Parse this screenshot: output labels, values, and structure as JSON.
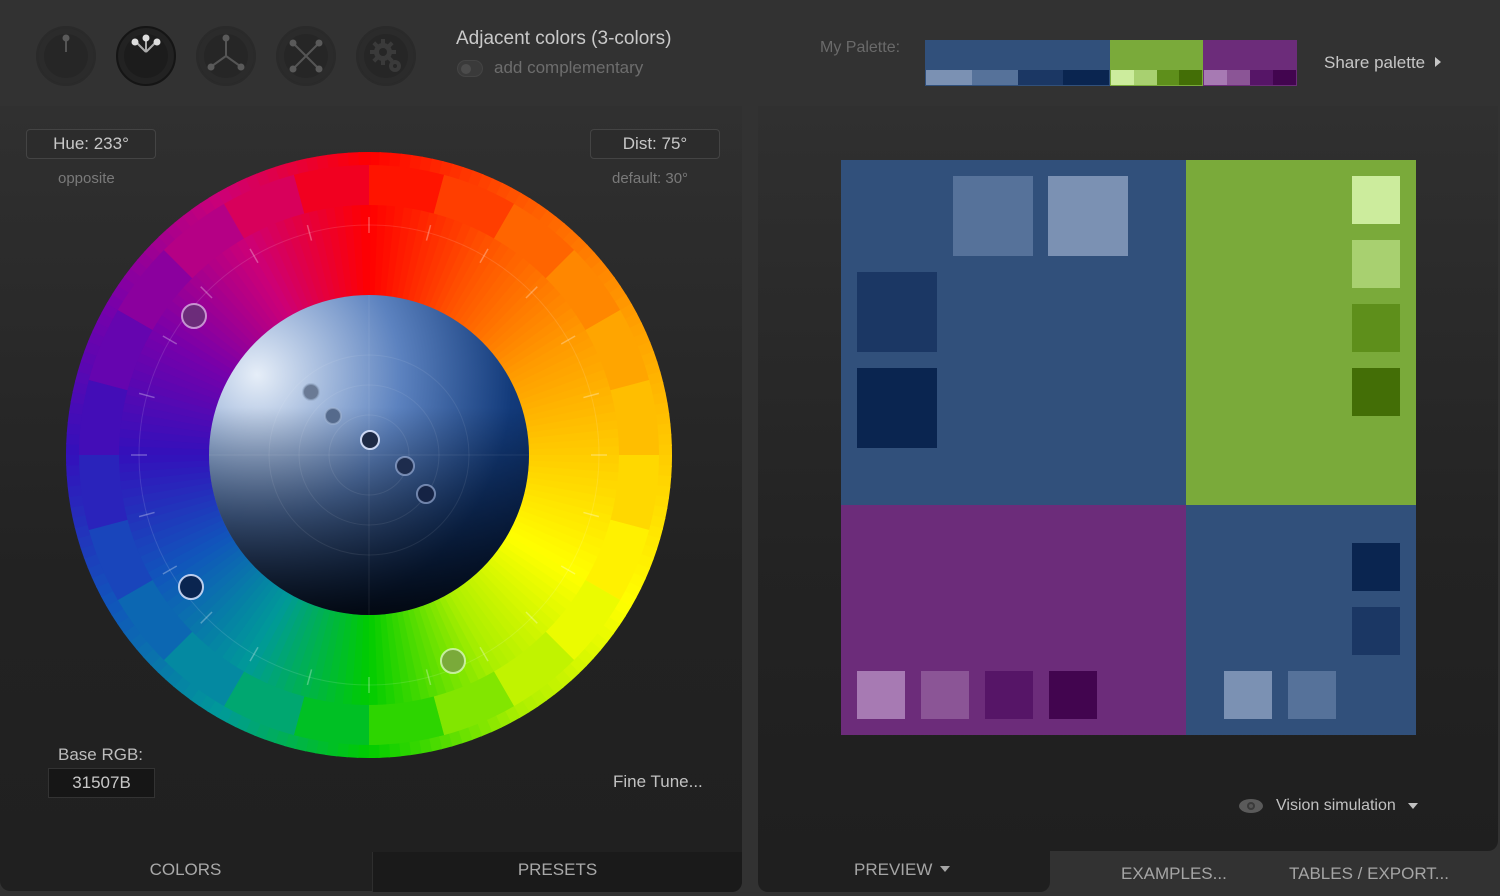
{
  "header": {
    "modes": [
      {
        "name": "mono",
        "label": "Monochromatic",
        "active": false
      },
      {
        "name": "adjacent",
        "label": "Adjacent colors",
        "active": true
      },
      {
        "name": "triad",
        "label": "Triad",
        "active": false
      },
      {
        "name": "tetrad",
        "label": "Tetrad",
        "active": false
      },
      {
        "name": "freestyle",
        "label": "Freestyle",
        "active": false
      }
    ],
    "rule_title": "Adjacent colors (3-colors)",
    "complementary_label": "add complementary",
    "complementary_on": false,
    "my_palette_label": "My Palette:",
    "share_label": "Share palette"
  },
  "palette": [
    {
      "main": "#31507B",
      "shades": [
        "#7B91B3",
        "#56729A",
        "#1B3764",
        "#0A2550"
      ]
    },
    {
      "main": "#7AAA3A",
      "shades": [
        "#CCEC9D",
        "#A8D070",
        "#5E8F1B",
        "#436E06"
      ]
    },
    {
      "main": "#6C2C7A",
      "shades": [
        "#A77AB3",
        "#8B5596",
        "#561567",
        "#42054F"
      ]
    }
  ],
  "wheel": {
    "hue_label": "Hue: 233°",
    "hue_sub": "opposite",
    "dist_label": "Dist: 75°",
    "dist_sub": "default: 30°",
    "base_rgb_label": "Base RGB:",
    "base_rgb_value": "31507B",
    "fine_tune_label": "Fine Tune...",
    "hue_markers": [
      {
        "name": "base",
        "color": "#0A2550"
      },
      {
        "name": "adjacent-1",
        "color": "#6C2C7A"
      },
      {
        "name": "adjacent-2",
        "color": "#7AAA3A"
      }
    ]
  },
  "left_tabs": {
    "colors": "COLORS",
    "presets": "PRESETS"
  },
  "right_tabs": {
    "preview": "PREVIEW",
    "examples": "EXAMPLES...",
    "tables": "TABLES / EXPORT..."
  },
  "vision_label": "Vision simulation"
}
